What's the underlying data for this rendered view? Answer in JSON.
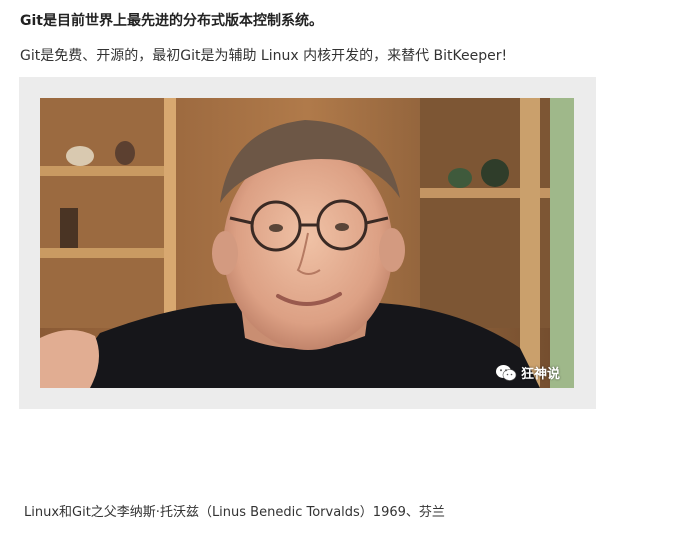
{
  "article": {
    "heading": "Git是目前世界上最先进的分布式版本控制系统。",
    "intro": "Git是免费、开源的，最初Git是为辅助 Linux 内核开发的，来替代 BitKeeper!",
    "photo": {
      "watermark_text": "狂神说",
      "watermark_icon": "wechat-icon"
    },
    "caption": "Linux和Git之父李纳斯·托沃兹（Linus Benedic Torvalds）1969、芬兰"
  }
}
